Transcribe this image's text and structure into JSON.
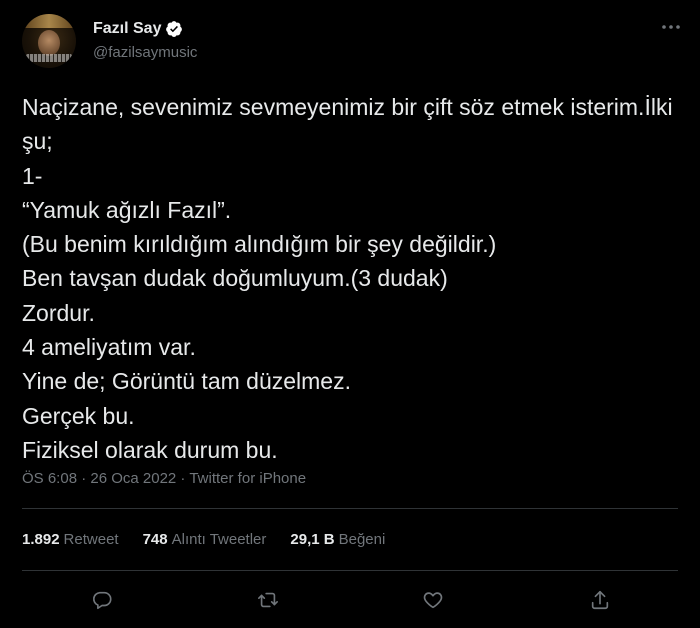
{
  "author": {
    "display_name": "Fazıl Say",
    "handle": "@fazilsaymusic",
    "verified_icon": "verified-badge-icon"
  },
  "tweet": {
    "text": "Naçizane, sevenimiz sevmeyenimiz bir çift söz etmek isterim.İlki şu;\n1-\n“Yamuk ağızlı Fazıl”.\n(Bu benim kırıldığım alındığım bir şey değildir.)\nBen tavşan dudak doğumluyum.(3 dudak)\nZordur.\n4 ameliyatım var.\nYine de; Görüntü tam düzelmez.\nGerçek bu.\nFiziksel olarak durum bu.",
    "timestamp": "ÖS 6:08 · 26 Oca 2022 ·",
    "source": "Twitter for iPhone"
  },
  "stats": {
    "retweets_count": "1.892",
    "retweets_label": "Retweet",
    "quotes_count": "748",
    "quotes_label": "Alıntı Tweetler",
    "likes_count": "29,1 B",
    "likes_label": "Beğeni"
  },
  "actions": [
    "reply-icon",
    "retweet-icon",
    "like-icon",
    "share-icon"
  ],
  "colors": {
    "background": "#000000",
    "text": "#e7e9ea",
    "muted": "#71767b",
    "divider": "#2f3336",
    "verified": "#ffffff"
  }
}
